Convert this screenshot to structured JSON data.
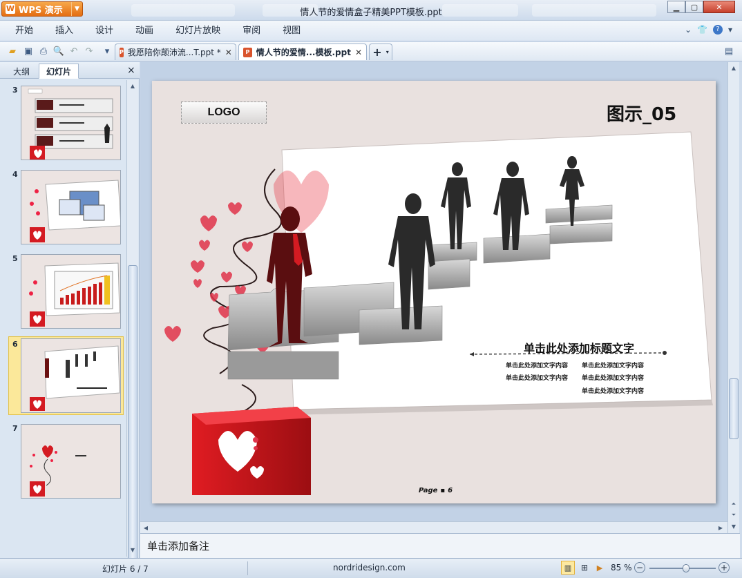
{
  "app": {
    "name": "WPS 演示",
    "window_title": "情人节的爱情盒子精美PPT模板.ppt"
  },
  "menu": [
    "开始",
    "插入",
    "设计",
    "动画",
    "幻灯片放映",
    "审阅",
    "视图"
  ],
  "doc_tabs": [
    {
      "label": "我愿陪你颠沛流...T.ppt *",
      "active": false
    },
    {
      "label": "情人节的爱情...模板.ppt",
      "active": true
    }
  ],
  "pane": {
    "tab_outline": "大纲",
    "tab_slides": "幻灯片",
    "close": "×"
  },
  "thumbnails": [
    {
      "num": "3",
      "selected": false
    },
    {
      "num": "4",
      "selected": false
    },
    {
      "num": "5",
      "selected": false
    },
    {
      "num": "6",
      "selected": true
    },
    {
      "num": "7",
      "selected": false
    }
  ],
  "slide": {
    "logo": "LOGO",
    "title": "图示_05",
    "caption_title": "单击此处添加标题文字",
    "caption_lines": [
      "单击此处添加文字内容",
      "单击此处添加文字内容",
      "单击此处添加文字内容",
      "单击此处添加文字内容",
      "单击此处添加文字内容"
    ],
    "page_label": "Page",
    "page_num": "6"
  },
  "notes_placeholder": "单击添加备注",
  "status": {
    "slide_counter": "幻灯片 6 / 7",
    "theme": "nordridesign.com",
    "zoom": "85 %",
    "zoom_level": 0.55
  },
  "colors": {
    "accent": "#e46d12",
    "heart_red": "#d41b22",
    "selection": "#fbe89a"
  }
}
